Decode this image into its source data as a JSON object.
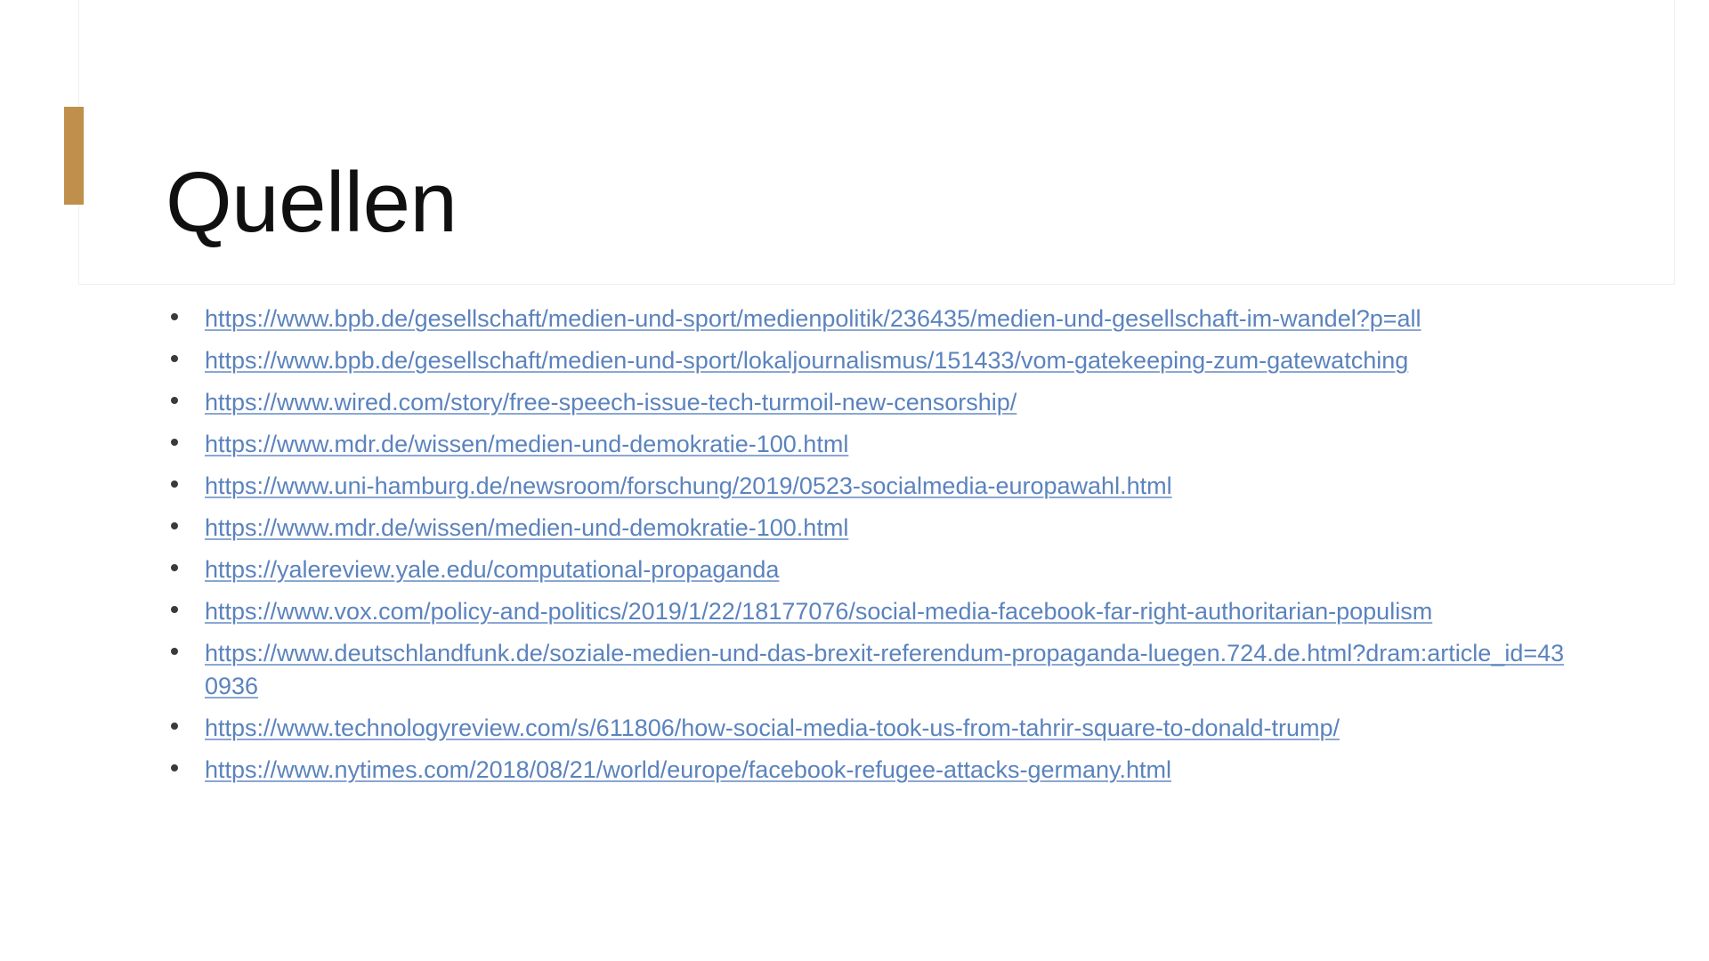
{
  "slide": {
    "title": "Quellen",
    "accent_color": "#c08f4b",
    "link_color": "#5b83bd",
    "background_color": "#ffffff",
    "title_color": "#101010"
  },
  "sources": [
    {
      "bullet": "•",
      "url": "https://www.bpb.de/gesellschaft/medien-und-sport/medienpolitik/236435/medien-und-gesellschaft-im-wandel?p=all",
      "wraps": false
    },
    {
      "bullet": "•",
      "url": "https://www.bpb.de/gesellschaft/medien-und-sport/lokaljournalismus/151433/vom-gatekeeping-zum-gatewatching",
      "wraps": true
    },
    {
      "bullet": "•",
      "url": "https://www.wired.com/story/free-speech-issue-tech-turmoil-new-censorship/",
      "wraps": false
    },
    {
      "bullet": "•",
      "url": "https://www.mdr.de/wissen/medien-und-demokratie-100.html",
      "wraps": false
    },
    {
      "bullet": "•",
      "url": "https://www.uni-hamburg.de/newsroom/forschung/2019/0523-socialmedia-europawahl.html",
      "wraps": false
    },
    {
      "bullet": "•",
      "url": "https://www.mdr.de/wissen/medien-und-demokratie-100.html",
      "wraps": false
    },
    {
      "bullet": "•",
      "url": "https://yalereview.yale.edu/computational-propaganda",
      "wraps": false
    },
    {
      "bullet": "•",
      "url": "https://www.vox.com/policy-and-politics/2019/1/22/18177076/social-media-facebook-far-right-authoritarian-populism",
      "wraps": true
    },
    {
      "bullet": "•",
      "url": "https://www.deutschlandfunk.de/soziale-medien-und-das-brexit-referendum-propaganda-luegen.724.de.html?dram:article_id=430936",
      "wraps": true
    },
    {
      "bullet": "•",
      "url": "https://www.technologyreview.com/s/611806/how-social-media-took-us-from-tahrir-square-to-donald-trump/",
      "wraps": false
    },
    {
      "bullet": "•",
      "url": "https://www.nytimes.com/2018/08/21/world/europe/facebook-refugee-attacks-germany.html",
      "wraps": false
    }
  ]
}
